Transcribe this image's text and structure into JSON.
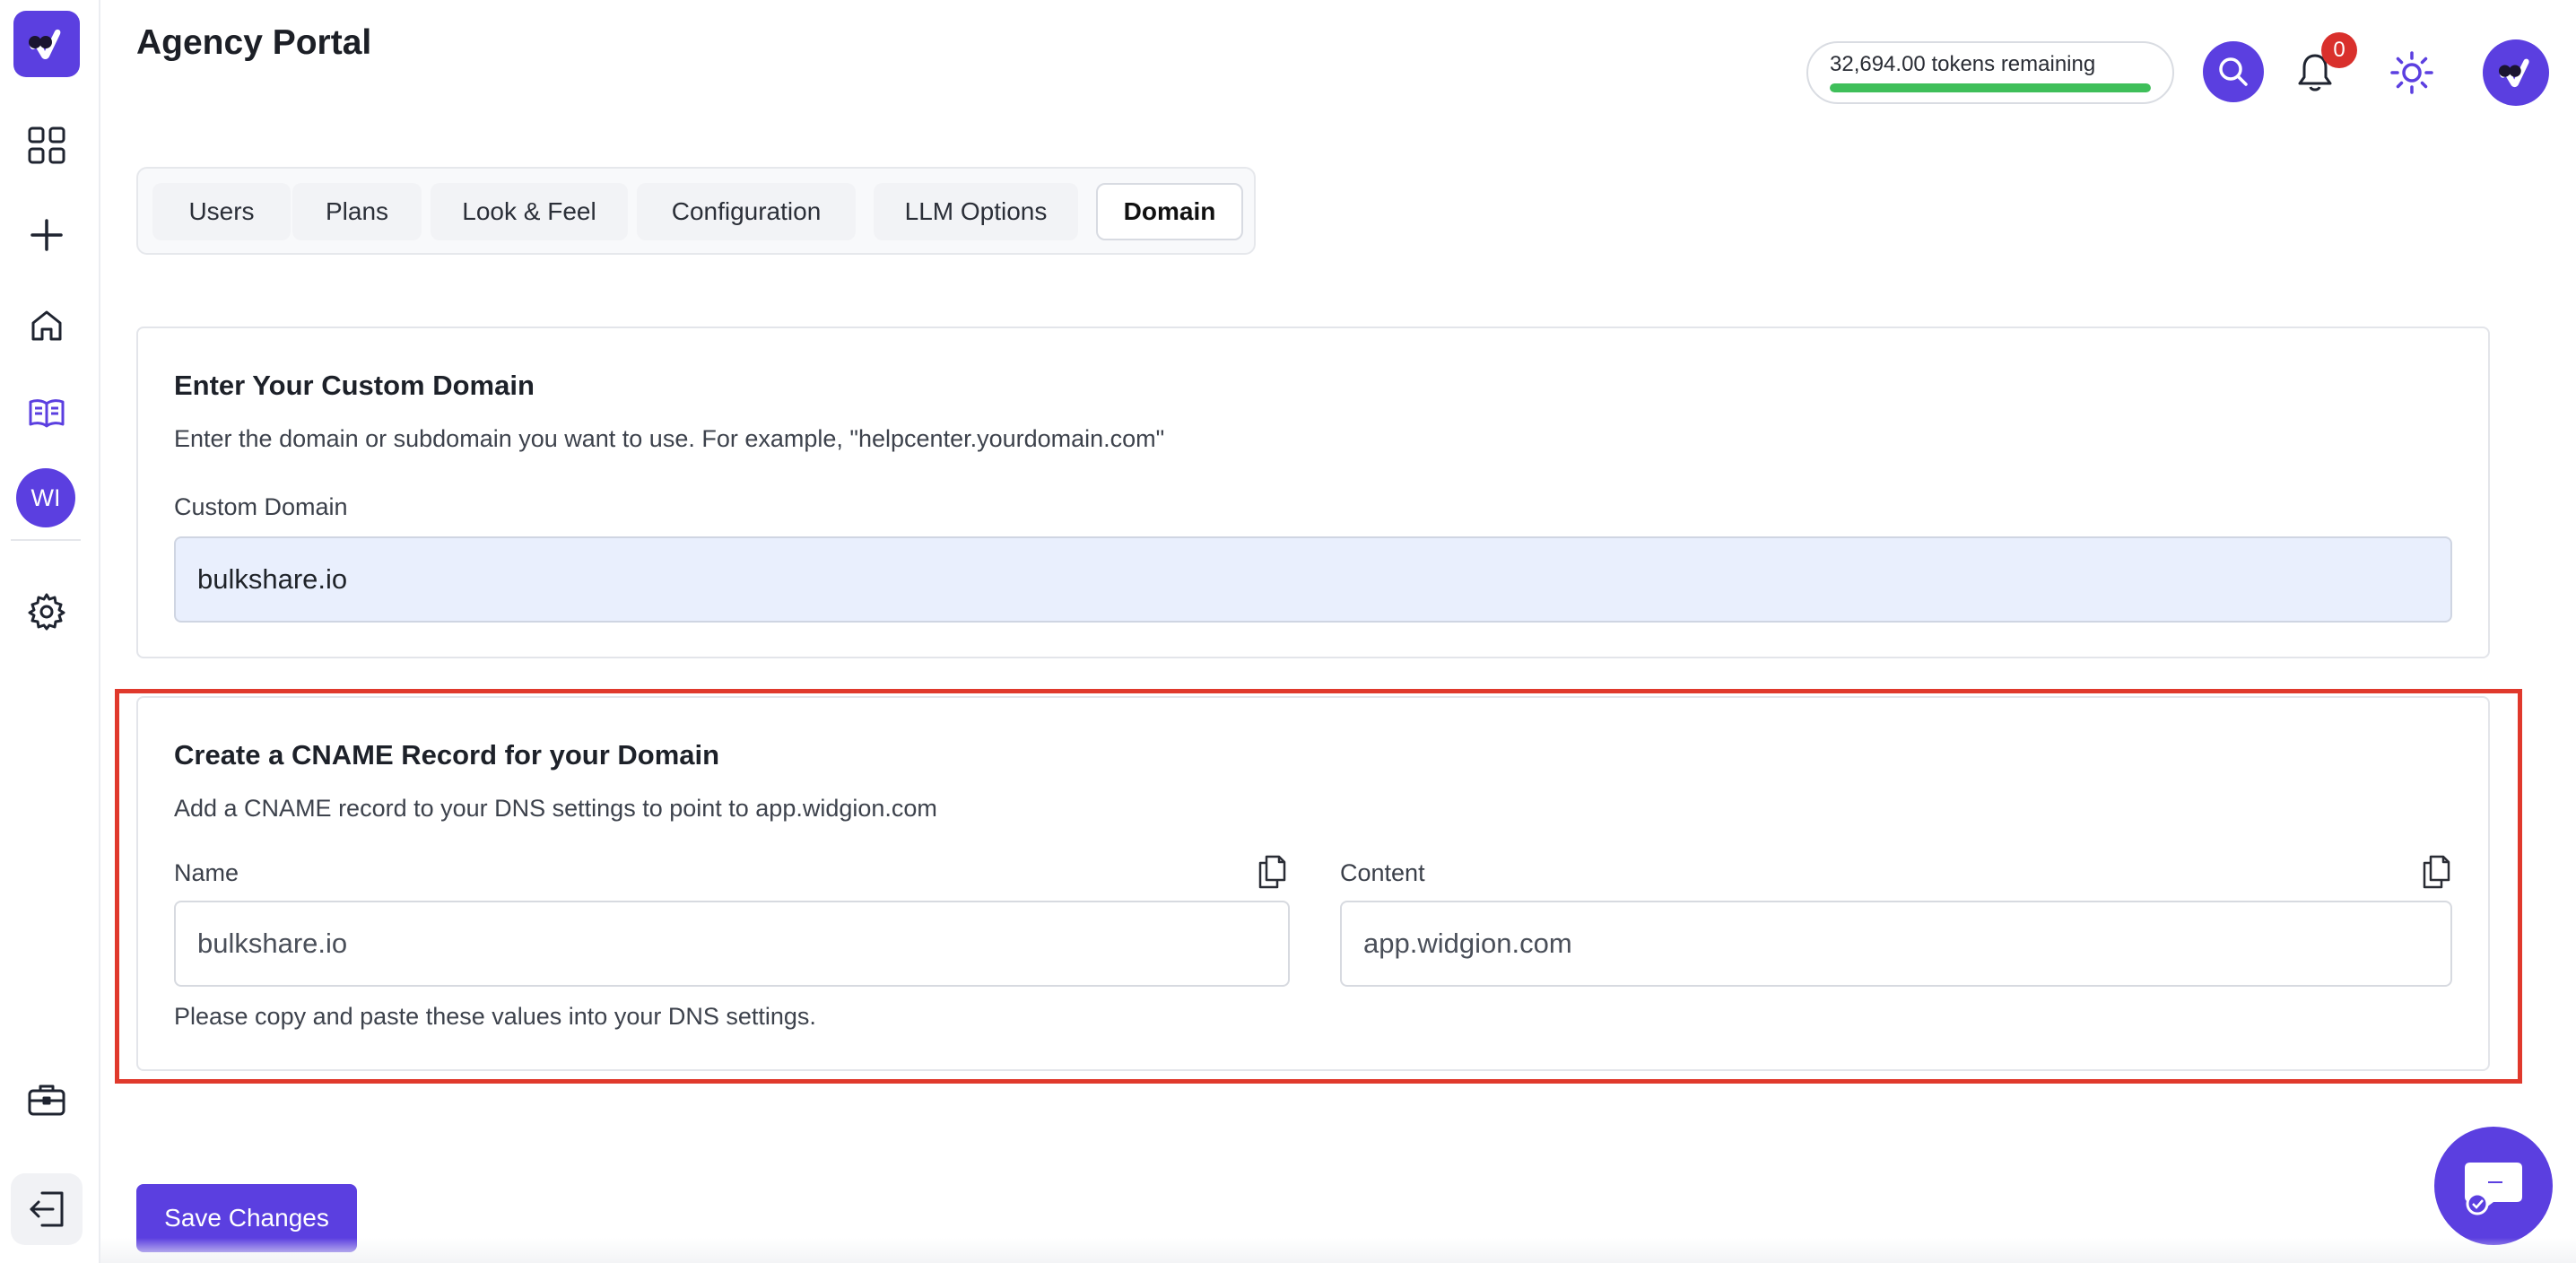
{
  "header": {
    "title": "Agency Portal",
    "tokens_text": "32,694.00 tokens remaining",
    "tokens_fraction": 1.0,
    "notification_count": "0"
  },
  "sidebar": {
    "avatar_initials": "WI",
    "icons": [
      "grid-icon",
      "plus-icon",
      "home-icon",
      "book-icon",
      "gear-icon",
      "briefcase-icon",
      "logout-icon"
    ]
  },
  "tabs": [
    {
      "label": "Users"
    },
    {
      "label": "Plans"
    },
    {
      "label": "Look & Feel"
    },
    {
      "label": "Configuration"
    },
    {
      "label": "LLM Options"
    },
    {
      "label": "Domain",
      "active": true
    }
  ],
  "custom_domain": {
    "title": "Enter Your Custom Domain",
    "description": "Enter the domain or subdomain you want to use. For example, \"helpcenter.yourdomain.com\"",
    "field_label": "Custom Domain",
    "value": "bulkshare.io"
  },
  "cname": {
    "title": "Create a CNAME Record for your Domain",
    "description": "Add a CNAME record to your DNS settings to point to app.widgion.com",
    "name_label": "Name",
    "name_value": "bulkshare.io",
    "content_label": "Content",
    "content_value": "app.widgion.com",
    "note": "Please copy and paste these values into your DNS settings."
  },
  "actions": {
    "save_label": "Save Changes"
  },
  "colors": {
    "brand": "#5b3fe0",
    "highlight": "#e0392c",
    "progress": "#3fbf5a",
    "badge": "#d9302c"
  }
}
